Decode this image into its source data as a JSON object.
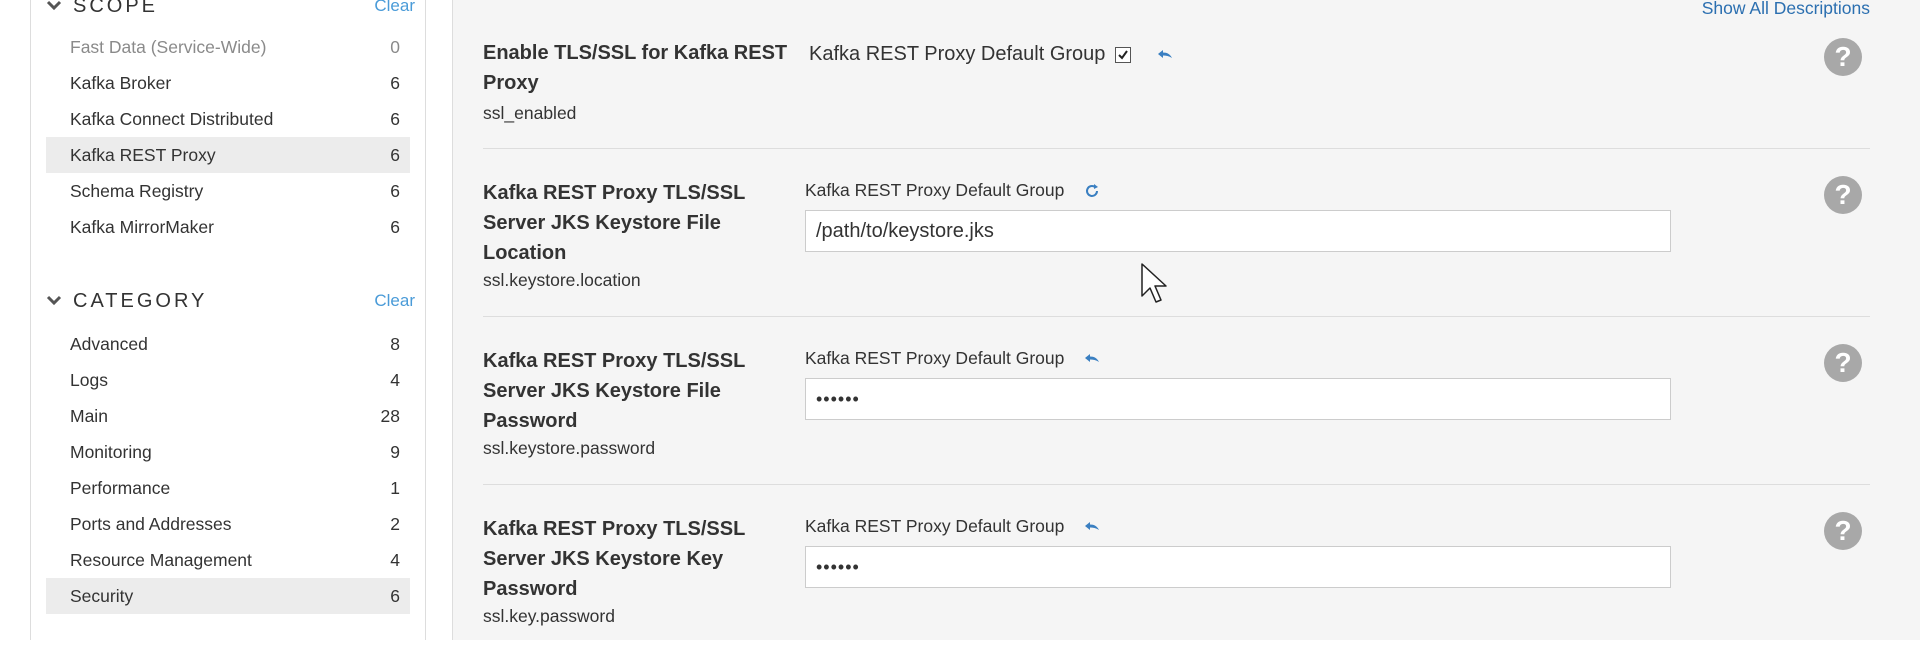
{
  "sidebar": {
    "scope": {
      "title": "SCOPE",
      "clear": "Clear",
      "items": [
        {
          "label": "Fast Data (Service-Wide)",
          "count": "0"
        },
        {
          "label": "Kafka Broker",
          "count": "6"
        },
        {
          "label": "Kafka Connect Distributed",
          "count": "6"
        },
        {
          "label": "Kafka REST Proxy",
          "count": "6"
        },
        {
          "label": "Schema Registry",
          "count": "6"
        },
        {
          "label": "Kafka MirrorMaker",
          "count": "6"
        }
      ]
    },
    "category": {
      "title": "CATEGORY",
      "clear": "Clear",
      "items": [
        {
          "label": "Advanced",
          "count": "8"
        },
        {
          "label": "Logs",
          "count": "4"
        },
        {
          "label": "Main",
          "count": "28"
        },
        {
          "label": "Monitoring",
          "count": "9"
        },
        {
          "label": "Performance",
          "count": "1"
        },
        {
          "label": "Ports and Addresses",
          "count": "2"
        },
        {
          "label": "Resource Management",
          "count": "4"
        },
        {
          "label": "Security",
          "count": "6"
        }
      ]
    }
  },
  "main": {
    "show_all": "Show All Descriptions",
    "properties": [
      {
        "name": "Enable TLS/SSL for Kafka REST Proxy",
        "key": "ssl_enabled",
        "group": "Kafka REST Proxy Default Group"
      },
      {
        "name": "Kafka REST Proxy TLS/SSL Server JKS Keystore File Location",
        "key": "ssl.keystore.location",
        "group": "Kafka REST Proxy Default Group",
        "value": "/path/to/keystore.jks"
      },
      {
        "name": "Kafka REST Proxy TLS/SSL Server JKS Keystore File Password",
        "key": "ssl.keystore.password",
        "group": "Kafka REST Proxy Default Group",
        "value": "••••••"
      },
      {
        "name": "Kafka REST Proxy TLS/SSL Server JKS Keystore Key Password",
        "key": "ssl.key.password",
        "group": "Kafka REST Proxy Default Group",
        "value": "••••••"
      }
    ]
  },
  "icons": {
    "chevron": "chevron-down-icon",
    "undo": "undo-arrow-icon",
    "refresh": "refresh-icon",
    "help": "help-icon",
    "checkbox": "checkbox-checked-icon",
    "cursor": "mouse-pointer-icon"
  },
  "colors": {
    "accent": "#4a9bd8",
    "link": "#2b6fb0",
    "active_row": "#ececec",
    "main_bg": "#f5f5f5",
    "help_icon": "#a8a8a8"
  }
}
